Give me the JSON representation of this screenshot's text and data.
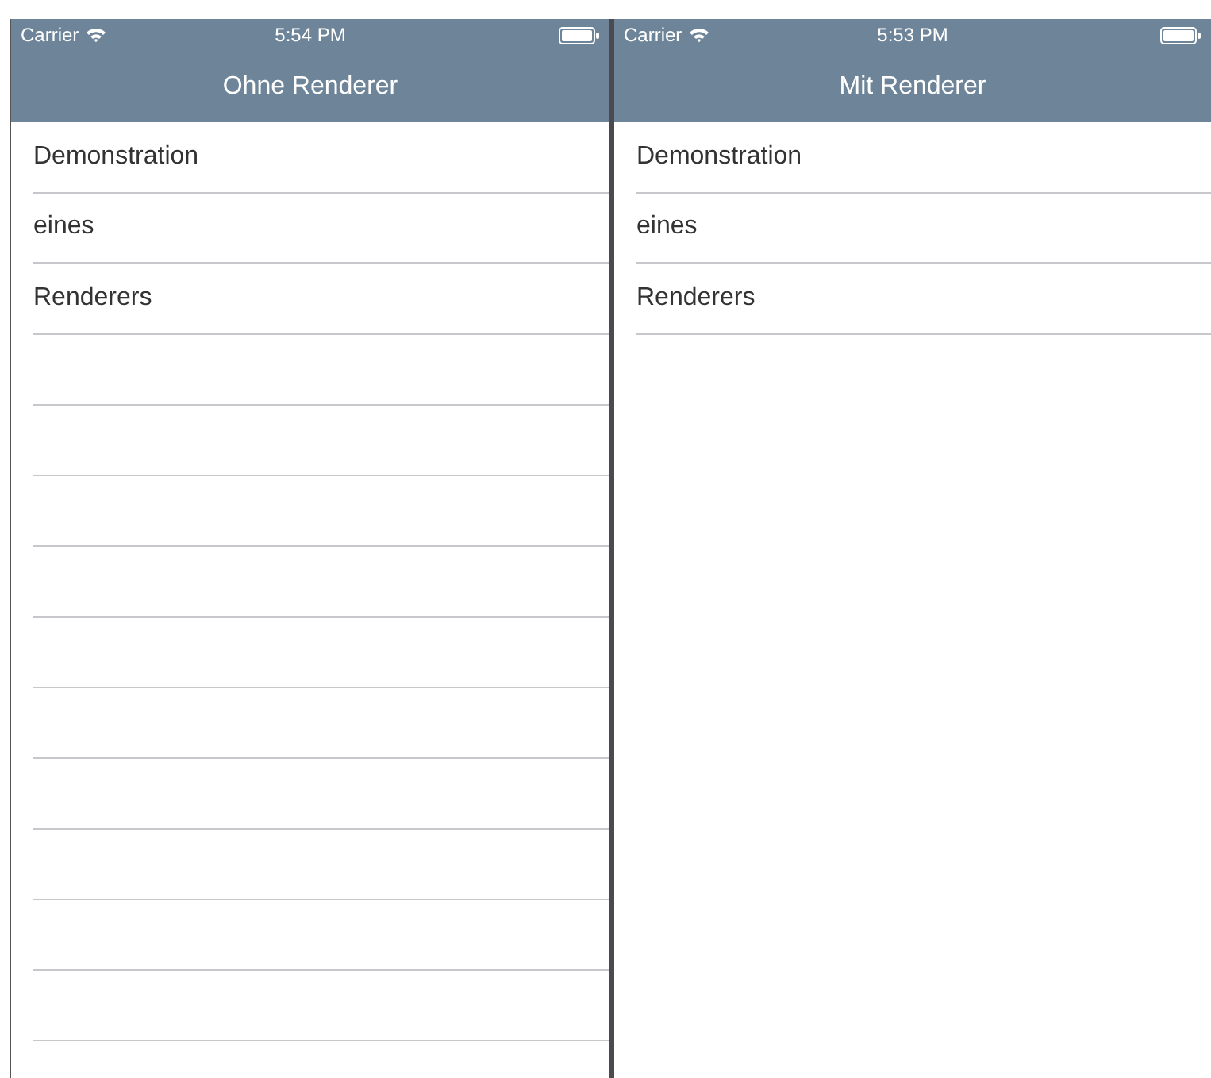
{
  "screens": [
    {
      "status_bar": {
        "carrier": "Carrier",
        "time": "5:54 PM"
      },
      "title": "Ohne Renderer",
      "rows": [
        "Demonstration",
        "eines",
        "Renderers"
      ],
      "empty_row_separators": true
    },
    {
      "status_bar": {
        "carrier": "Carrier",
        "time": "5:53 PM"
      },
      "title": "Mit Renderer",
      "rows": [
        "Demonstration",
        "eines",
        "Renderers"
      ],
      "empty_row_separators": false
    }
  ]
}
